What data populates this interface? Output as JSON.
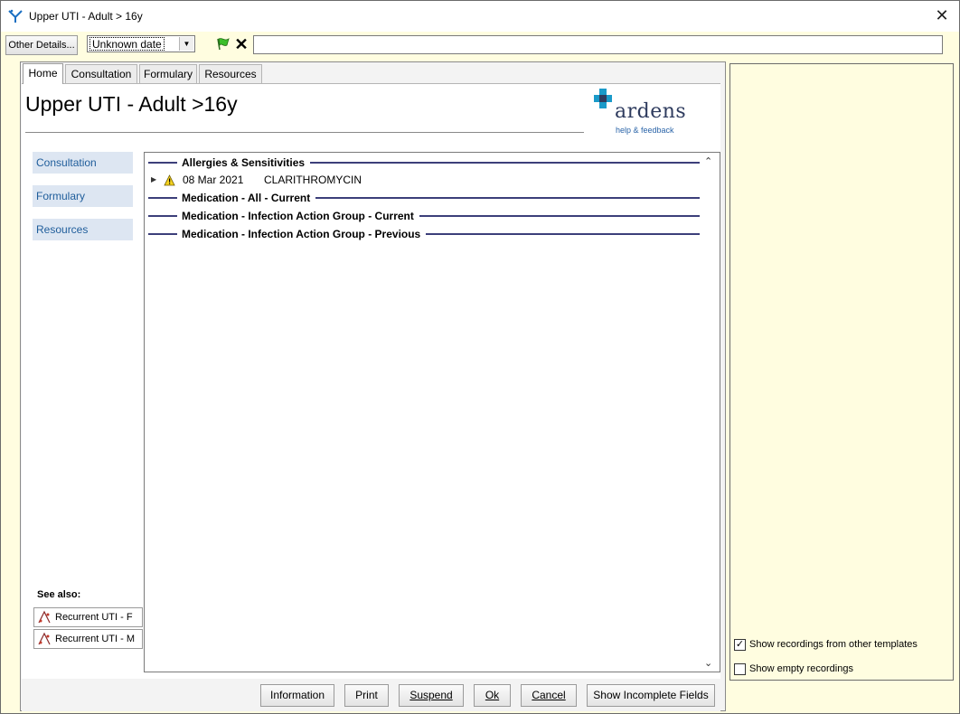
{
  "window": {
    "title": "Upper UTI - Adult > 16y",
    "close_glyph": "✕"
  },
  "toolbar": {
    "other_details_label": "Other Details...",
    "date_value": "Unknown date",
    "free_text_value": ""
  },
  "tabs": [
    {
      "label": "Home",
      "active": true
    },
    {
      "label": "Consultation",
      "active": false
    },
    {
      "label": "Formulary",
      "active": false
    },
    {
      "label": "Resources",
      "active": false
    }
  ],
  "page": {
    "title": "Upper UTI - Adult >16y",
    "logo_text": "ardens",
    "logo_link": "help & feedback"
  },
  "side_nav": [
    {
      "label": "Consultation"
    },
    {
      "label": "Formulary"
    },
    {
      "label": "Resources"
    }
  ],
  "sections": {
    "allergies": "Allergies & Sensitivities",
    "med_all_current": "Medication - All - Current",
    "med_iag_current": "Medication - Infection Action Group - Current",
    "med_iag_previous": "Medication - Infection Action Group - Previous"
  },
  "allergy_rows": [
    {
      "date": "08 Mar 2021",
      "name": "CLARITHROMYCIN"
    }
  ],
  "see_also": {
    "label": "See also:",
    "links": [
      {
        "label": "Recurrent UTI - F"
      },
      {
        "label": "Recurrent UTI - M"
      }
    ]
  },
  "bottom_buttons": {
    "information": "Information",
    "print": "Print",
    "suspend": "Suspend",
    "ok": "Ok",
    "cancel": "Cancel",
    "show_incomplete": "Show Incomplete Fields"
  },
  "right_panel": {
    "show_other_templates": {
      "label": "Show recordings from other templates",
      "checked": true
    },
    "show_empty": {
      "label": "Show empty recordings",
      "checked": false
    }
  },
  "colors": {
    "panel_bg": "#fffde0",
    "nav_bg": "#dde6f2",
    "nav_text": "#1f5d9b",
    "section_rule": "#3c3f7a",
    "logo_cross": "#1a9ac9"
  }
}
